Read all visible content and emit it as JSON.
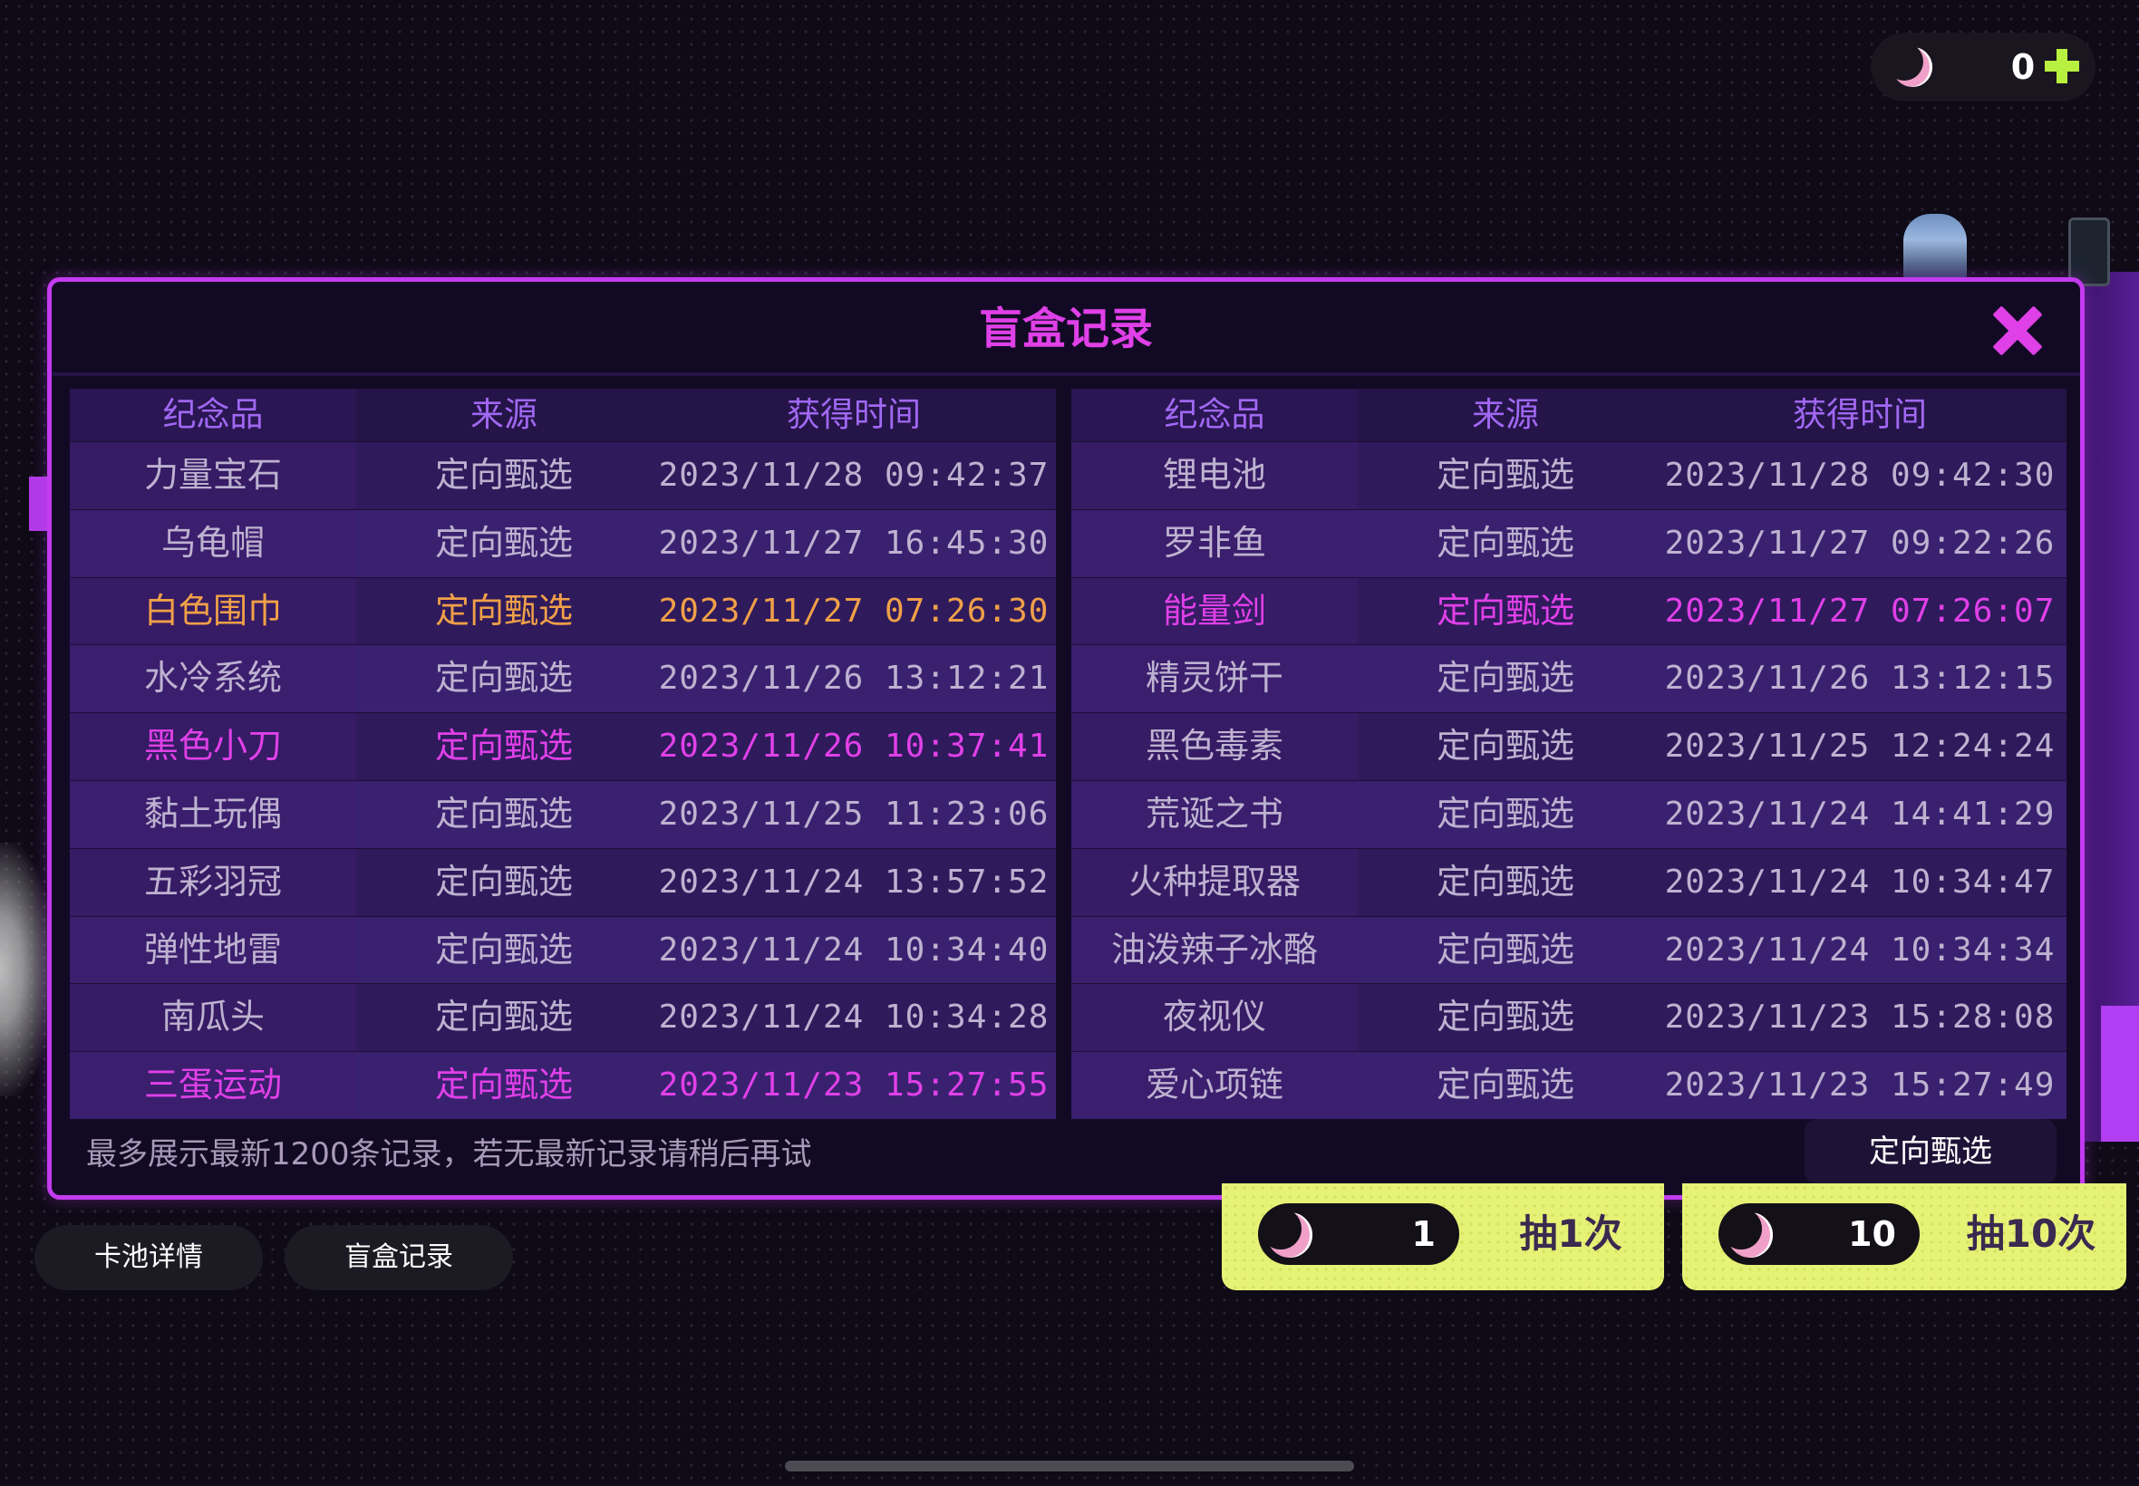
{
  "currency": {
    "amount": "0",
    "icon": "moon-coin-icon",
    "add_icon": "plus-icon"
  },
  "modal": {
    "title": "盲盒记录",
    "close_icon": "close-icon",
    "headers": {
      "item": "纪念品",
      "source": "来源",
      "time": "获得时间"
    },
    "left_rows": [
      {
        "item": "力量宝石",
        "source": "定向甄选",
        "time": "2023/11/28 09:42:37",
        "rarity": "normal"
      },
      {
        "item": "乌龟帽",
        "source": "定向甄选",
        "time": "2023/11/27 16:45:30",
        "rarity": "normal"
      },
      {
        "item": "白色围巾",
        "source": "定向甄选",
        "time": "2023/11/27 07:26:30",
        "rarity": "orange"
      },
      {
        "item": "水冷系统",
        "source": "定向甄选",
        "time": "2023/11/26 13:12:21",
        "rarity": "normal"
      },
      {
        "item": "黑色小刀",
        "source": "定向甄选",
        "time": "2023/11/26 10:37:41",
        "rarity": "magenta"
      },
      {
        "item": "黏土玩偶",
        "source": "定向甄选",
        "time": "2023/11/25 11:23:06",
        "rarity": "normal"
      },
      {
        "item": "五彩羽冠",
        "source": "定向甄选",
        "time": "2023/11/24 13:57:52",
        "rarity": "normal"
      },
      {
        "item": "弹性地雷",
        "source": "定向甄选",
        "time": "2023/11/24 10:34:40",
        "rarity": "normal"
      },
      {
        "item": "南瓜头",
        "source": "定向甄选",
        "time": "2023/11/24 10:34:28",
        "rarity": "normal"
      },
      {
        "item": "三蛋运动",
        "source": "定向甄选",
        "time": "2023/11/23 15:27:55",
        "rarity": "magenta"
      }
    ],
    "right_rows": [
      {
        "item": "锂电池",
        "source": "定向甄选",
        "time": "2023/11/28 09:42:30",
        "rarity": "normal"
      },
      {
        "item": "罗非鱼",
        "source": "定向甄选",
        "time": "2023/11/27 09:22:26",
        "rarity": "normal"
      },
      {
        "item": "能量剑",
        "source": "定向甄选",
        "time": "2023/11/27 07:26:07",
        "rarity": "magenta"
      },
      {
        "item": "精灵饼干",
        "source": "定向甄选",
        "time": "2023/11/26 13:12:15",
        "rarity": "normal"
      },
      {
        "item": "黑色毒素",
        "source": "定向甄选",
        "time": "2023/11/25 12:24:24",
        "rarity": "normal"
      },
      {
        "item": "荒诞之书",
        "source": "定向甄选",
        "time": "2023/11/24 14:41:29",
        "rarity": "normal"
      },
      {
        "item": "火种提取器",
        "source": "定向甄选",
        "time": "2023/11/24 10:34:47",
        "rarity": "normal"
      },
      {
        "item": "油泼辣子冰酪",
        "source": "定向甄选",
        "time": "2023/11/24 10:34:34",
        "rarity": "normal"
      },
      {
        "item": "夜视仪",
        "source": "定向甄选",
        "time": "2023/11/23 15:28:08",
        "rarity": "normal"
      },
      {
        "item": "爱心项链",
        "source": "定向甄选",
        "time": "2023/11/23 15:27:49",
        "rarity": "normal"
      }
    ],
    "footer_note": "最多展示最新1200条记录，若无最新记录请稍后再试",
    "filter_button": "定向甄选"
  },
  "bottom_buttons": {
    "pool_detail": "卡池详情",
    "box_record": "盲盒记录"
  },
  "draw": {
    "single": {
      "cost": "1",
      "label": "抽1次"
    },
    "ten": {
      "cost": "10",
      "label": "抽10次"
    }
  },
  "colors": {
    "accent_magenta": "#e040e8",
    "rare_orange": "#f0a048",
    "header_purple": "#a068f2",
    "draw_button_yellow": "#e6f276"
  }
}
